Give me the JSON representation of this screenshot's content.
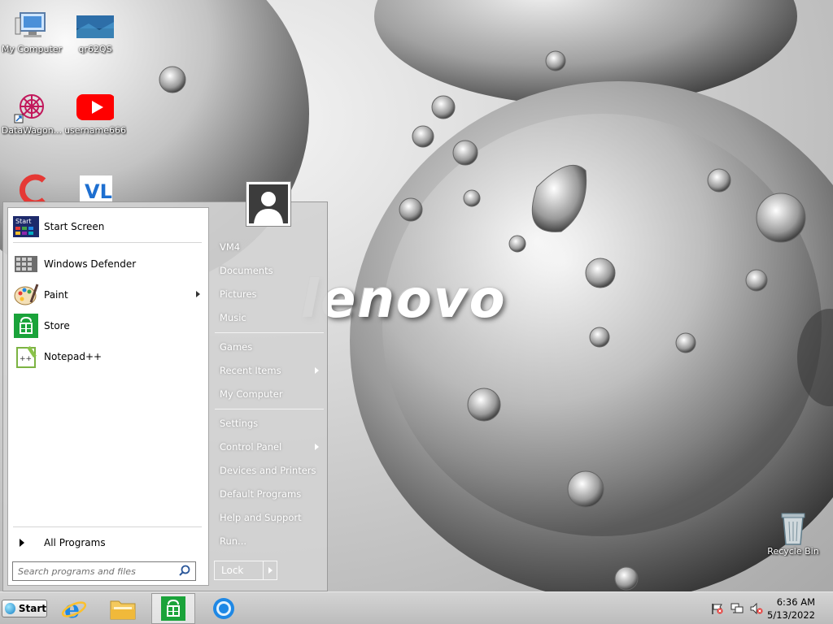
{
  "desktop": {
    "wallpaper_brand": "lenovo",
    "icons": [
      {
        "label": "My Computer",
        "icon": "computer-icon"
      },
      {
        "label": "qr62QS",
        "icon": "image-file-icon"
      },
      {
        "label": "DataWagon...",
        "icon": "datawagon-icon"
      },
      {
        "label": "username666",
        "icon": "youtube-icon"
      },
      {
        "label": "",
        "icon": "ccleaner-icon"
      },
      {
        "label": "",
        "icon": "vl-app-icon"
      },
      {
        "label": "Recycle Bin",
        "icon": "recycle-bin-icon"
      }
    ]
  },
  "start_menu": {
    "programs": [
      {
        "label": "Start Screen",
        "icon": "start-screen-icon",
        "badge": "Start",
        "has_submenu": false
      },
      {
        "label": "Windows Defender",
        "icon": "windows-defender-icon",
        "has_submenu": false
      },
      {
        "label": "Paint",
        "icon": "paint-icon",
        "has_submenu": true
      },
      {
        "label": "Store",
        "icon": "store-icon",
        "has_submenu": false
      },
      {
        "label": "Notepad++",
        "icon": "notepadpp-icon",
        "has_submenu": false
      }
    ],
    "all_programs_label": "All Programs",
    "search_placeholder": "Search programs and files",
    "right_items": [
      {
        "label": "VM4"
      },
      {
        "label": "Documents"
      },
      {
        "label": "Pictures"
      },
      {
        "label": "Music"
      },
      {
        "label": "Games"
      },
      {
        "label": "Recent Items",
        "has_submenu": true
      },
      {
        "label": "My Computer"
      },
      {
        "label": "Settings"
      },
      {
        "label": "Control Panel",
        "has_submenu": true
      },
      {
        "label": "Devices and Printers"
      },
      {
        "label": "Default Programs"
      },
      {
        "label": "Help and Support"
      },
      {
        "label": "Run..."
      }
    ],
    "lock_label": "Lock"
  },
  "taskbar": {
    "start_label": "Start",
    "pinned": [
      {
        "name": "internet-explorer-icon"
      },
      {
        "name": "file-explorer-icon"
      },
      {
        "name": "store-icon",
        "active": true
      },
      {
        "name": "chrome-icon"
      }
    ],
    "tray": [
      "action-center-flag-icon",
      "network-icon",
      "volume-muted-icon"
    ],
    "time": "6:36 AM",
    "date": "5/13/2022"
  },
  "colors": {
    "store_green": "#1aa33a",
    "youtube_red": "#ff0000",
    "start_menu_right_text": "#ffffff"
  }
}
